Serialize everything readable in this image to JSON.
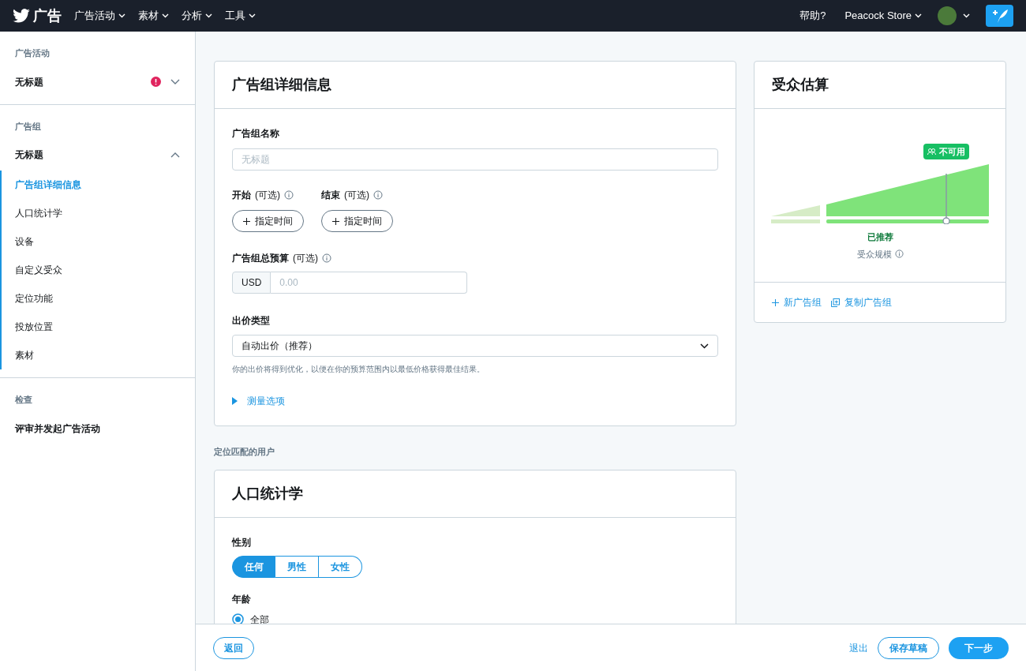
{
  "topbar": {
    "logo_text": "广告",
    "nav": [
      {
        "label": "广告活动"
      },
      {
        "label": "素材"
      },
      {
        "label": "分析"
      },
      {
        "label": "工具"
      }
    ],
    "help": "帮助?",
    "account": "Peacock Store"
  },
  "sidebar": {
    "sections": [
      {
        "heading": "广告活动",
        "title": "无标题",
        "has_error": true,
        "expanded": false
      },
      {
        "heading": "广告组",
        "title": "无标题",
        "has_error": false,
        "expanded": true,
        "items": [
          {
            "label": "广告组详细信息",
            "selected": true
          },
          {
            "label": "人口统计学",
            "selected": false
          },
          {
            "label": "设备",
            "selected": false
          },
          {
            "label": "自定义受众",
            "selected": false
          },
          {
            "label": "定位功能",
            "selected": false
          },
          {
            "label": "投放位置",
            "selected": false
          },
          {
            "label": "素材",
            "selected": false
          }
        ]
      },
      {
        "heading": "检查",
        "title": "评审并发起广告活动",
        "has_error": false
      }
    ]
  },
  "details": {
    "title": "广告组详细信息",
    "name_field": {
      "label": "广告组名称",
      "placeholder": "无标题"
    },
    "dates": [
      {
        "label": "开始",
        "optional": "(可选)",
        "button": "指定时间"
      },
      {
        "label": "结束",
        "optional": "(可选)",
        "button": "指定时间"
      }
    ],
    "budget": {
      "label": "广告组总预算",
      "optional": "(可选)",
      "currency": "USD",
      "placeholder": "0.00"
    },
    "bid": {
      "label": "出价类型",
      "value": "自动出价（推荐）",
      "help": "你的出价将得到优化，以便在你的预算范围内以最低价格获得最佳结果。"
    },
    "measurement": {
      "label": "测量选项",
      "expanded": false
    }
  },
  "section_label": "定位匹配的用户",
  "demographics": {
    "title": "人口统计学",
    "gender": {
      "label": "性别",
      "options": [
        {
          "label": "任何",
          "selected": true
        },
        {
          "label": "男性",
          "selected": false
        },
        {
          "label": "女性",
          "selected": false
        }
      ]
    },
    "age": {
      "label": "年龄",
      "options": [
        {
          "label": "全部",
          "selected": true
        }
      ]
    }
  },
  "audience": {
    "title": "受众估算",
    "badge": "不可用",
    "status": "已推荐",
    "size_label": "受众规模",
    "actions": [
      {
        "kind": "new",
        "label": "新广告组"
      },
      {
        "kind": "copy",
        "label": "复制广告组"
      }
    ]
  },
  "footer": {
    "back": "返回",
    "exit": "退出",
    "save": "保存草稿",
    "next": "下一步"
  }
}
